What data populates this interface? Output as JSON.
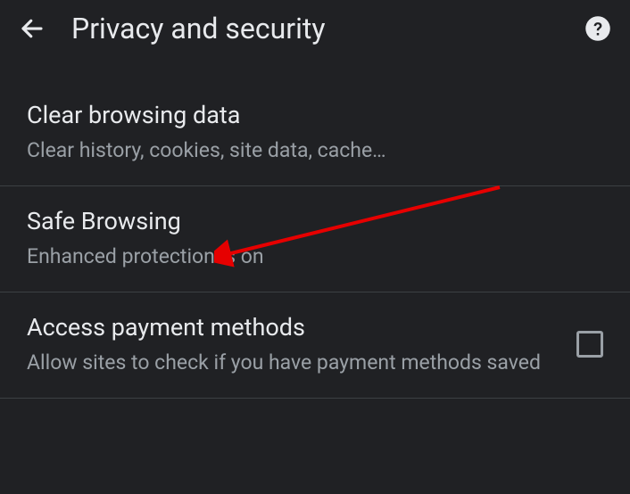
{
  "header": {
    "title": "Privacy and security"
  },
  "items": [
    {
      "title": "Clear browsing data",
      "subtitle": "Clear history, cookies, site data, cache…"
    },
    {
      "title": "Safe Browsing",
      "subtitle": "Enhanced protection is on"
    },
    {
      "title": "Access payment methods",
      "subtitle": "Allow sites to check if you have payment methods saved"
    }
  ],
  "annotation": {
    "arrow_color": "#e60000"
  }
}
